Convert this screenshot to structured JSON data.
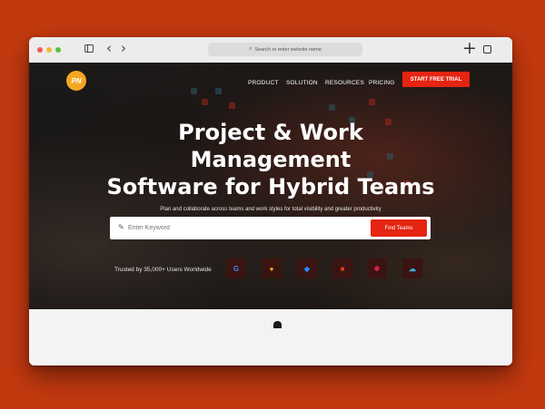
{
  "browser": {
    "address_placeholder": "Search or enter website name"
  },
  "site": {
    "logo_text": "PN",
    "nav": {
      "product": "PRODUCT",
      "solution": "SOLUTION",
      "resources": "RESOURCES",
      "pricing": "PRICING"
    },
    "cta_label": "START FREE TRIAL"
  },
  "hero": {
    "headline_line1": "Project & Work",
    "headline_line2": "Management",
    "headline_line3": "Software for Hybrid Teams",
    "subline": "Plan and collaborate across teams and work styles for total visibility and greater productivity",
    "search_placeholder": "Enter Keyword",
    "search_button": "Find Teams",
    "trusted_text": "Trusted by 35,000+ Users Worldwide",
    "partners": [
      {
        "icon": "google-icon",
        "glyph": "G",
        "color": "#4285f4",
        "bg": "#3a1410"
      },
      {
        "icon": "orange-globe-icon",
        "glyph": "●",
        "color": "#f5a623",
        "bg": "#3a1410"
      },
      {
        "icon": "jira-icon",
        "glyph": "◆",
        "color": "#2684ff",
        "bg": "#3a1410"
      },
      {
        "icon": "office-icon",
        "glyph": "■",
        "color": "#e8391f",
        "bg": "#3a1410"
      },
      {
        "icon": "slack-icon",
        "glyph": "✱",
        "color": "#e01e5a",
        "bg": "#3a1410"
      },
      {
        "icon": "cloud-icon",
        "glyph": "☁",
        "color": "#3aa8e0",
        "bg": "#3a1410"
      }
    ]
  }
}
